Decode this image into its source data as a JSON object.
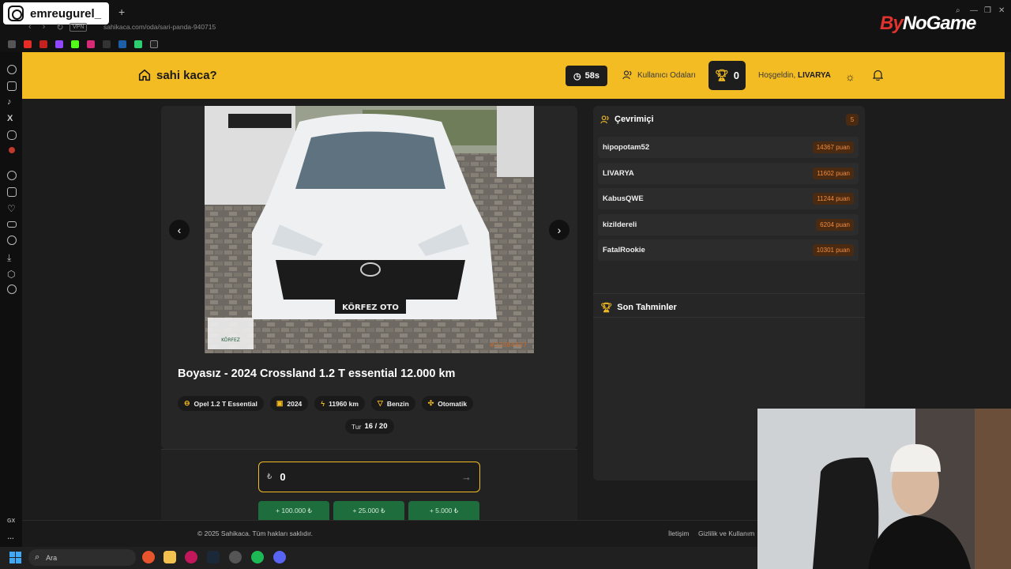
{
  "overlay": {
    "instagram_handle": "emreugurel_",
    "watermark_by": "By",
    "watermark_rest": "NoGame"
  },
  "browser": {
    "url": "sahikaca.com/oda/sari-panda-940715",
    "vpn": "VPN",
    "new_tab": "+"
  },
  "header": {
    "logo": "sahi kaca?",
    "timer": "58s",
    "rooms_label": "Kullanıcı Odaları",
    "score": "0",
    "welcome_prefix": "Hoşgeldin,",
    "username": "LIVARYA"
  },
  "listing": {
    "title": "Boyasız - 2024 Crossland 1.2 T essential 12.000 km",
    "tags": [
      {
        "icon": "car-icon",
        "label": "Opel 1.2 T Essential"
      },
      {
        "icon": "calendar-icon",
        "label": "2024"
      },
      {
        "icon": "gauge-icon",
        "label": "11960 km"
      },
      {
        "icon": "fuel-icon",
        "label": "Benzin"
      },
      {
        "icon": "gear-shift-icon",
        "label": "Otomatik"
      }
    ],
    "round_prefix": "Tur",
    "round_value": "16 / 20",
    "photo_plate": "KÖRFEZ OTO",
    "photo_logo_text": "KÖRFEZ",
    "photo_code": "#22884407"
  },
  "guess": {
    "currency": "₺",
    "value": "0",
    "quick_add": [
      "+ 100.000 ₺",
      "+ 25.000 ₺",
      "+ 5.000 ₺"
    ]
  },
  "online": {
    "title": "Çevrimiçi",
    "count": "5",
    "users": [
      {
        "name": "hipopotam52",
        "points": "14367 puan"
      },
      {
        "name": "LIVARYA",
        "points": "11602 puan"
      },
      {
        "name": "KabusQWE",
        "points": "11244 puan"
      },
      {
        "name": "kizildereli",
        "points": "6204 puan"
      },
      {
        "name": "FatalRookie",
        "points": "10301 puan"
      }
    ]
  },
  "recent": {
    "title": "Son Tahminler"
  },
  "footer": {
    "copyright": "© 2025 Sahikaca. Tüm hakları saklıdır.",
    "links": [
      "İletişim",
      "Gizlilik ve Kullanım"
    ]
  },
  "taskbar": {
    "search_placeholder": "Ara"
  },
  "colors": {
    "accent": "#f4bc23",
    "points_bg": "#4b2a12",
    "points_fg": "#f28c3c",
    "quick_add": "#1e6d3d"
  }
}
